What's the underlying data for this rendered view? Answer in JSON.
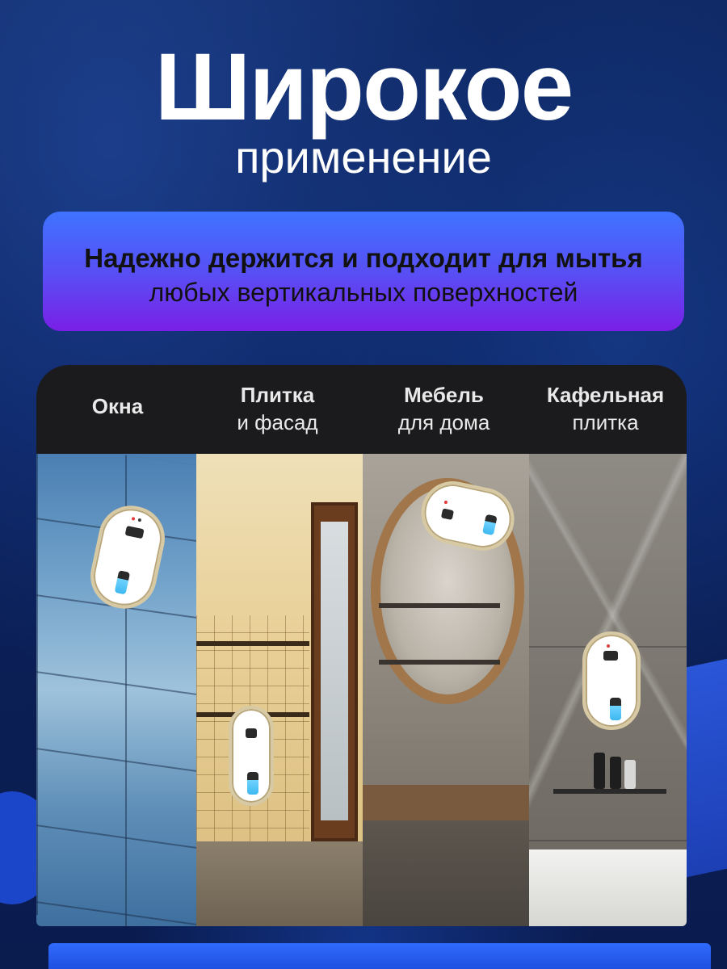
{
  "header": {
    "title": "Широкое",
    "subtitle": "применение"
  },
  "banner": {
    "line1": "Надежно держится и подходит для мытья",
    "line2": "любых вертикальных поверхностей"
  },
  "surfaces": [
    {
      "label_line1": "Окна",
      "label_line2": ""
    },
    {
      "label_line1": "Плитка",
      "label_line2": "и фасад"
    },
    {
      "label_line1": "Мебель",
      "label_line2": "для дома"
    },
    {
      "label_line1": "Кафельная",
      "label_line2": "плитка"
    }
  ],
  "colors": {
    "background": "#0f2a66",
    "banner_top": "#3f73ff",
    "banner_bottom": "#7a1fe6",
    "card": "#1b1b1d",
    "robot": "#ffffff",
    "robot_tank": "#3db8f0"
  },
  "icons": [
    "window-cleaning-robot"
  ]
}
